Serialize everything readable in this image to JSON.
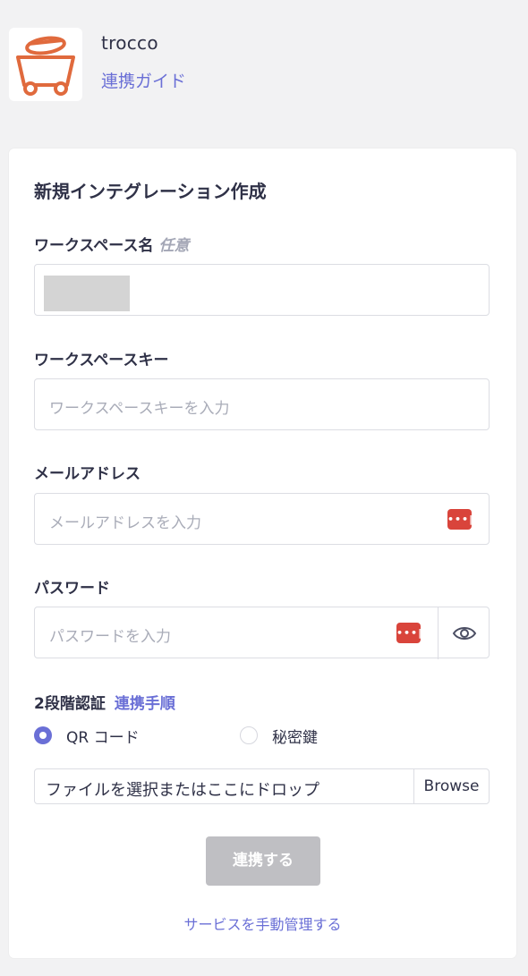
{
  "header": {
    "app_name": "trocco",
    "guide_link": "連携ガイド",
    "logo_icon": "mine-cart-icon",
    "logo_color": "#e06a3d"
  },
  "form": {
    "title": "新規インテグレーション作成",
    "workspace_name": {
      "label": "ワークスペース名",
      "optional": "任意"
    },
    "workspace_key": {
      "label": "ワークスペースキー",
      "placeholder": "ワークスペースキーを入力"
    },
    "email": {
      "label": "メールアドレス",
      "placeholder": "メールアドレスを入力"
    },
    "password": {
      "label": "パスワード",
      "placeholder": "パスワードを入力"
    },
    "mfa": {
      "label": "2段階認証",
      "link": "連携手順",
      "options": [
        {
          "label": "QR コード",
          "selected": true
        },
        {
          "label": "秘密鍵",
          "selected": false
        }
      ]
    },
    "file": {
      "text": "ファイルを選択またはここにドロップ",
      "browse": "Browse"
    },
    "submit_label": "連携する",
    "manual_link": "サービスを手動管理する"
  },
  "colors": {
    "accent": "#6a6fd6",
    "password_manager": "#d9443b",
    "disabled_button": "#bfbfc3"
  }
}
